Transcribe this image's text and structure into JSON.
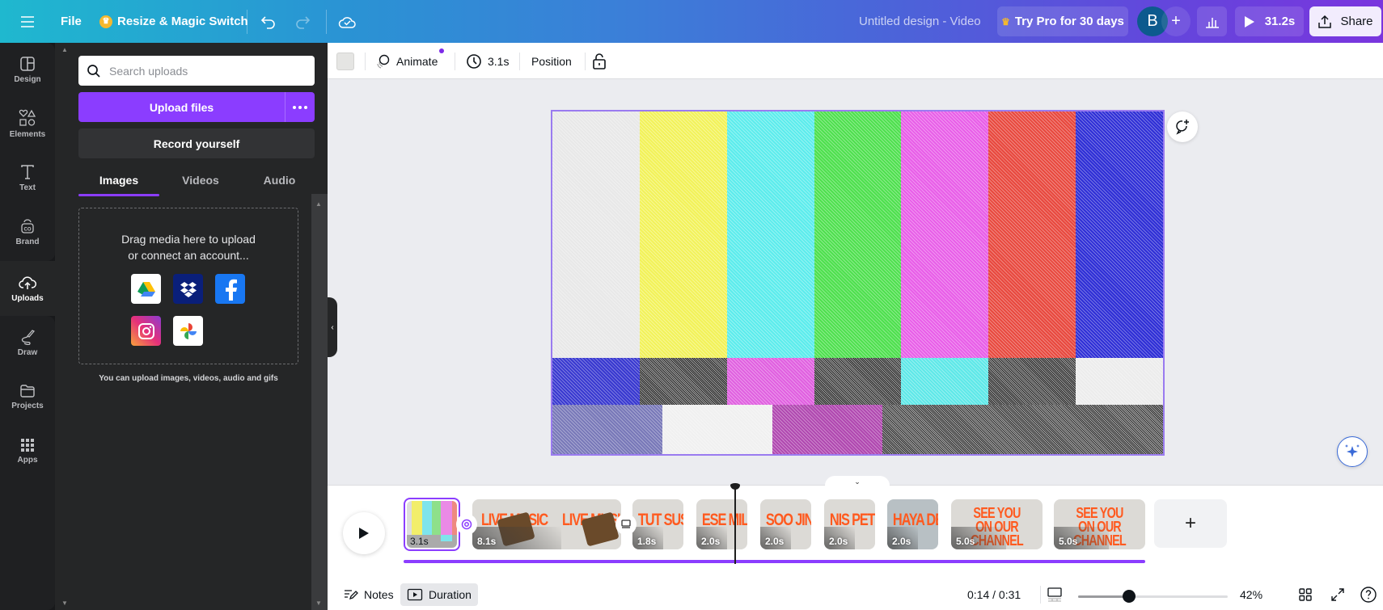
{
  "topbar": {
    "menu_icon": "hamburger-menu-icon",
    "file_label": "File",
    "resize_label": "Resize & Magic Switch",
    "design_title": "Untitled design - Video",
    "try_pro_label": "Try Pro for 30 days",
    "avatar_initial": "B",
    "play_duration": "31.2s",
    "share_label": "Share"
  },
  "rail": {
    "items": [
      {
        "label": "Design",
        "icon": "layout-icon"
      },
      {
        "label": "Elements",
        "icon": "shapes-icon"
      },
      {
        "label": "Text",
        "icon": "text-icon"
      },
      {
        "label": "Brand",
        "icon": "brand-icon"
      },
      {
        "label": "Uploads",
        "icon": "cloud-upload-icon",
        "active": true
      },
      {
        "label": "Draw",
        "icon": "pen-icon"
      },
      {
        "label": "Projects",
        "icon": "folder-icon"
      },
      {
        "label": "Apps",
        "icon": "apps-grid-icon"
      }
    ]
  },
  "uploads_panel": {
    "search_placeholder": "Search uploads",
    "upload_files_label": "Upload files",
    "record_label": "Record yourself",
    "tabs": [
      {
        "label": "Images",
        "active": true
      },
      {
        "label": "Videos"
      },
      {
        "label": "Audio"
      }
    ],
    "dropzone_line1": "Drag media here to upload",
    "dropzone_line2": "or connect an account...",
    "services": [
      "Google Drive",
      "Dropbox",
      "Facebook",
      "Instagram",
      "Google Photos"
    ],
    "hint": "You can upload images, videos, audio and gifs"
  },
  "toolbar": {
    "animate_label": "Animate",
    "duration_label": "3.1s",
    "position_label": "Position"
  },
  "canvas": {
    "description": "TV color bars test pattern with static noise",
    "top_bars": [
      "#e8e8e8",
      "#f2f25a",
      "#5cecec",
      "#4ee04e",
      "#e85ee8",
      "#e8483e",
      "#2e2ed6"
    ],
    "middle_bars": [
      "#3838d0",
      "#555555",
      "#e060e0",
      "#555555",
      "#5ee8e8",
      "#555555",
      "#ececec"
    ],
    "bottom_bars": [
      "#7878b8",
      "#f0f0f0",
      "#b048b0",
      "#666666"
    ]
  },
  "timeline": {
    "clips": [
      {
        "duration": "3.1s",
        "title": "",
        "selected": true
      },
      {
        "duration": "8.1s",
        "title": "LIVE MUSIC"
      },
      {
        "duration": "1.8s",
        "title": "TUT SUSI"
      },
      {
        "duration": "2.0s",
        "title": "ESE MILL"
      },
      {
        "duration": "2.0s",
        "title": "SOO JIN A"
      },
      {
        "duration": "2.0s",
        "title": "NIS PETR"
      },
      {
        "duration": "2.0s",
        "title": "HAYA DE"
      },
      {
        "duration": "5.0s",
        "title": "SEE YOU ON OUR CHANNEL"
      },
      {
        "duration": "5.0s",
        "title": "SEE YOU ON OUR CHANNEL"
      }
    ],
    "add_label": "+"
  },
  "bottombar": {
    "notes_label": "Notes",
    "duration_label": "Duration",
    "time_display": "0:14 / 0:31",
    "zoom_percent": "42%",
    "zoom_slider_value": 0.34
  },
  "colors": {
    "accent": "#8b3dff",
    "brand_orange": "#ff5a1f"
  }
}
